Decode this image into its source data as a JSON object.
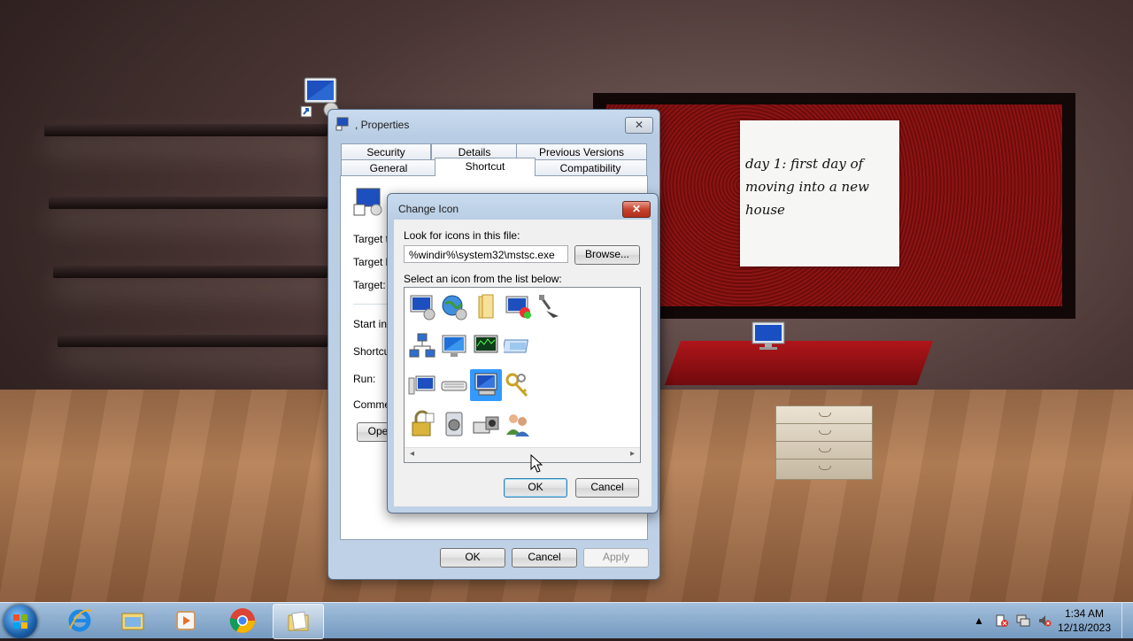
{
  "desktop": {
    "sticky_note": {
      "lines": [
        "day 1: first day of",
        "moving into a new",
        "house"
      ]
    }
  },
  "properties_window": {
    "title": ", Properties",
    "close_symbol": "✕",
    "tabs_row1": [
      "Security",
      "Details",
      "Previous Versions"
    ],
    "tabs_row2": [
      "General",
      "Shortcut",
      "Compatibility"
    ],
    "active_tab": "Shortcut",
    "field_labels": {
      "target_type": "Target ty",
      "target_location": "Target lo",
      "target": "Target:",
      "start_in": "Start in:",
      "shortcut_key": "Shortcut",
      "run": "Run:",
      "comment": "Commer",
      "open_button": "Oper"
    },
    "buttons": {
      "ok": "OK",
      "cancel": "Cancel",
      "apply": "Apply"
    }
  },
  "change_icon_dialog": {
    "title": "Change Icon",
    "close_symbol": "✕",
    "look_label": "Look for icons in this file:",
    "file_path": "%windir%\\system32\\mstsc.exe",
    "browse_button": "Browse...",
    "select_label": "Select an icon from the list below:",
    "ok_button": "OK",
    "cancel_button": "Cancel",
    "scroll_left": "◂",
    "scroll_right": "▸",
    "selected_icon": "remote-desktop-monitor-icon"
  },
  "taskbar": {
    "clock_time": "1:34 AM",
    "clock_date": "12/18/2023",
    "tray_overflow": "▲",
    "pinned": [
      "internet-explorer-icon",
      "windows-explorer-icon",
      "media-player-icon",
      "chrome-icon",
      "folder-icon"
    ]
  }
}
